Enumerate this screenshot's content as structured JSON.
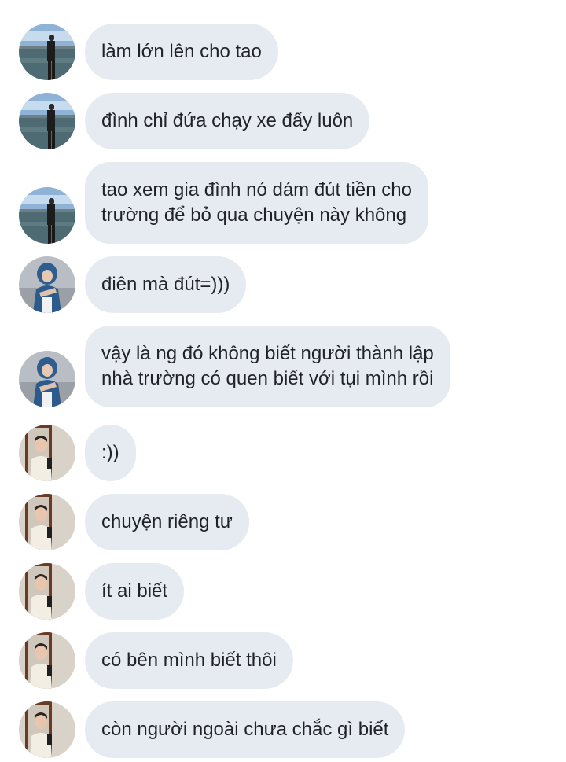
{
  "messages": [
    {
      "sender": "user-1",
      "avatar_icon": "lakeside-photo-avatar",
      "lines": [
        "làm lớn lên cho tao"
      ]
    },
    {
      "sender": "user-1",
      "avatar_icon": "lakeside-photo-avatar",
      "lines": [
        "đình chỉ đứa chạy xe đấy luôn"
      ]
    },
    {
      "sender": "user-1",
      "avatar_icon": "lakeside-photo-avatar",
      "lines": [
        "tao xem gia đình nó dám đút tiền cho",
        "trường để bỏ qua chuyện này không"
      ]
    },
    {
      "sender": "user-2",
      "avatar_icon": "blue-hood-photo-avatar",
      "lines": [
        "điên mà đút=)))"
      ]
    },
    {
      "sender": "user-2",
      "avatar_icon": "blue-hood-photo-avatar",
      "lines": [
        "vậy là ng đó không biết người thành lập",
        "nhà trường có quen biết với tụi mình rồi"
      ]
    },
    {
      "sender": "user-3",
      "avatar_icon": "mirror-selfie-avatar",
      "lines": [
        ":))"
      ]
    },
    {
      "sender": "user-3",
      "avatar_icon": "mirror-selfie-avatar",
      "lines": [
        "chuyện riêng tư"
      ]
    },
    {
      "sender": "user-3",
      "avatar_icon": "mirror-selfie-avatar",
      "lines": [
        "ít ai biết"
      ]
    },
    {
      "sender": "user-3",
      "avatar_icon": "mirror-selfie-avatar",
      "lines": [
        "có bên mình biết thôi"
      ]
    },
    {
      "sender": "user-3",
      "avatar_icon": "mirror-selfie-avatar",
      "lines": [
        "còn người ngoài chưa chắc gì biết"
      ]
    }
  ],
  "colors": {
    "bubble_bg": "#e6ebf2",
    "text": "#1f2328",
    "page_bg": "#ffffff"
  }
}
